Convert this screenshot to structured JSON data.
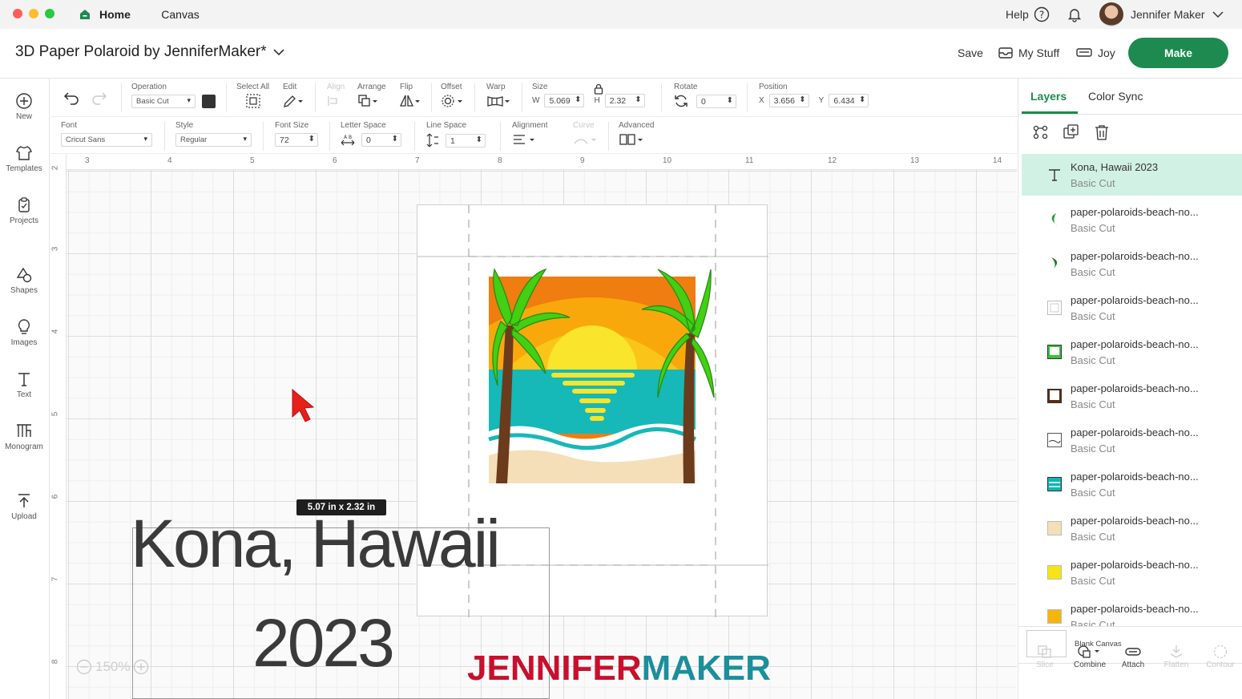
{
  "topbar": {
    "home_tab": "Home",
    "canvas_tab": "Canvas",
    "help": "Help",
    "user_name": "Jennifer Maker"
  },
  "titlebar": {
    "title": "3D Paper Polaroid by JenniferMaker*",
    "save": "Save",
    "my_stuff": "My Stuff",
    "machine": "Joy",
    "make": "Make"
  },
  "left_tools": [
    {
      "label": "New"
    },
    {
      "label": "Templates"
    },
    {
      "label": "Projects"
    },
    {
      "label": "Shapes"
    },
    {
      "label": "Images"
    },
    {
      "label": "Text"
    },
    {
      "label": "Monogram"
    },
    {
      "label": "Upload"
    }
  ],
  "toolbar1": {
    "operation_label": "Operation",
    "operation_value": "Basic Cut",
    "select_all": "Select All",
    "edit": "Edit",
    "align": "Align",
    "arrange": "Arrange",
    "flip": "Flip",
    "offset": "Offset",
    "warp": "Warp",
    "size_label": "Size",
    "w_label": "W",
    "w_value": "5.069",
    "h_label": "H",
    "h_value": "2.32",
    "rotate_label": "Rotate",
    "rotate_value": "0",
    "position_label": "Position",
    "x_label": "X",
    "x_value": "3.656",
    "y_label": "Y",
    "y_value": "6.434"
  },
  "toolbar2": {
    "font_label": "Font",
    "font_value": "Cricut Sans",
    "style_label": "Style",
    "style_value": "Regular",
    "font_size_label": "Font Size",
    "font_size_value": "72",
    "letter_space_label": "Letter Space",
    "letter_space_value": "0",
    "line_space_label": "Line Space",
    "line_space_value": "1",
    "alignment_label": "Alignment",
    "curve_label": "Curve",
    "advanced_label": "Advanced"
  },
  "rulers": {
    "top": [
      "3",
      "4",
      "5",
      "6",
      "7",
      "8",
      "9",
      "10",
      "11",
      "12",
      "13",
      "14"
    ],
    "left": [
      "2",
      "3",
      "4",
      "5",
      "6",
      "7",
      "8"
    ]
  },
  "canvas": {
    "size_tip": "5.07  in x 2.32  in",
    "text_line1": "Kona, Hawaii",
    "text_line2": "2023",
    "zoom": "150%",
    "watermark_a": "JENNIFER",
    "watermark_b": "MAKER"
  },
  "right_panel": {
    "tab_layers": "Layers",
    "tab_color_sync": "Color Sync",
    "layers": [
      {
        "name": "Kona, Hawaii 2023",
        "op": "Basic Cut",
        "icon": "text-icon"
      },
      {
        "name": "paper-polaroids-beach-no...",
        "op": "Basic Cut",
        "icon": "palm-leaf-icon",
        "color": "#2e9a2e"
      },
      {
        "name": "paper-polaroids-beach-no...",
        "op": "Basic Cut",
        "icon": "palm-leaf-icon",
        "color": "#1f7a1f"
      },
      {
        "name": "paper-polaroids-beach-no...",
        "op": "Basic Cut",
        "icon": "frame-icon",
        "color": "#ffffff"
      },
      {
        "name": "paper-polaroids-beach-no...",
        "op": "Basic Cut",
        "icon": "frame-icon",
        "color": "#3bbf3b"
      },
      {
        "name": "paper-polaroids-beach-no...",
        "op": "Basic Cut",
        "icon": "frame-icon",
        "color": "#5a2d14"
      },
      {
        "name": "paper-polaroids-beach-no...",
        "op": "Basic Cut",
        "icon": "frame-icon",
        "color": "#ffffff"
      },
      {
        "name": "paper-polaroids-beach-no...",
        "op": "Basic Cut",
        "icon": "frame-icon",
        "color": "#12b5b5"
      },
      {
        "name": "paper-polaroids-beach-no...",
        "op": "Basic Cut",
        "icon": "frame-icon",
        "color": "#f4dfb8"
      },
      {
        "name": "paper-polaroids-beach-no...",
        "op": "Basic Cut",
        "icon": "frame-icon",
        "color": "#f7e416"
      },
      {
        "name": "paper-polaroids-beach-no...",
        "op": "Basic Cut",
        "icon": "frame-icon",
        "color": "#f5b60a"
      }
    ],
    "blank_canvas": "Blank Canvas",
    "bottom_tools": [
      {
        "label": "Slice",
        "enabled": false
      },
      {
        "label": "Combine",
        "enabled": true
      },
      {
        "label": "Attach",
        "enabled": true
      },
      {
        "label": "Flatten",
        "enabled": false
      },
      {
        "label": "Contour",
        "enabled": false
      }
    ]
  },
  "colors": {
    "accent": "#1d8a4f",
    "layer_selected": "#d2f1e5",
    "watermark_red": "#c8102e",
    "watermark_teal": "#1b8f9b"
  }
}
